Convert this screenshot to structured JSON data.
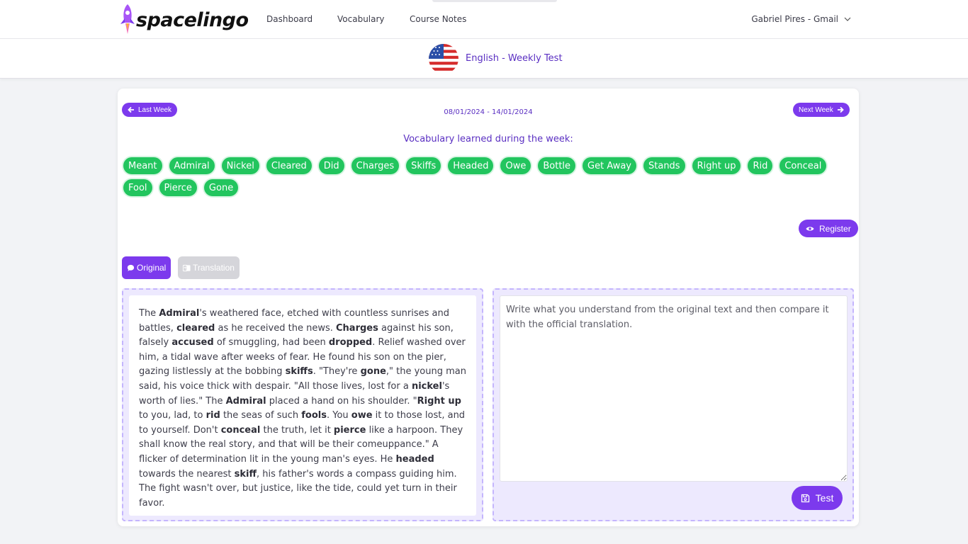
{
  "nav": {
    "logo_text": "spacelingo",
    "links": [
      "Dashboard",
      "Vocabulary",
      "Course Notes"
    ],
    "user": "Gabriel Pires - Gmail"
  },
  "header": {
    "title": "English - Weekly Test",
    "flag_icon": "us-flag-icon"
  },
  "week": {
    "prev_label": "Last Week",
    "next_label": "Next Week",
    "range": "08/01/2024 - 14/01/2024"
  },
  "vocab": {
    "title": "Vocabulary learned during the week:",
    "words": [
      "Meant",
      "Admiral",
      "Nickel",
      "Cleared",
      "Did",
      "Charges",
      "Skiffs",
      "Headed",
      "Owe",
      "Bottle",
      "Get Away",
      "Stands",
      "Right up",
      "Rid",
      "Conceal",
      "Fool",
      "Pierce",
      "Gone"
    ]
  },
  "register_label": "Register",
  "tabs": {
    "original": "Original",
    "translation": "Translation"
  },
  "original_text": [
    {
      "t": "The "
    },
    {
      "b": "Admiral"
    },
    {
      "t": "'s weathered face, etched with countless sunrises and battles, "
    },
    {
      "b": "cleared"
    },
    {
      "t": " as he received the news. "
    },
    {
      "b": "Charges"
    },
    {
      "t": " against his son, falsely "
    },
    {
      "b": "accused"
    },
    {
      "t": " of smuggling, had been "
    },
    {
      "b": "dropped"
    },
    {
      "t": ". Relief washed over him, a tidal wave after weeks of fear. He found his son on the pier, gazing listlessly at the bobbing "
    },
    {
      "b": "skiffs"
    },
    {
      "t": ". \"They're "
    },
    {
      "b": "gone"
    },
    {
      "t": ",\" the young man said, his voice thick with despair. \"All those lives, lost for a "
    },
    {
      "b": "nickel"
    },
    {
      "t": "'s worth of lies.\" The "
    },
    {
      "b": "Admiral"
    },
    {
      "t": " placed a hand on his shoulder. \""
    },
    {
      "b": "Right up"
    },
    {
      "t": " to you, lad, to "
    },
    {
      "b": "rid"
    },
    {
      "t": " the seas of such "
    },
    {
      "b": "fools"
    },
    {
      "t": ". You "
    },
    {
      "b": "owe"
    },
    {
      "t": " it to those lost, and to yourself. Don't "
    },
    {
      "b": "conceal"
    },
    {
      "t": " the truth, let it "
    },
    {
      "b": "pierce"
    },
    {
      "t": " like a harpoon. They shall know the real story, and that will be their comeuppance.\" A flicker of determination lit in the young man's eyes. He "
    },
    {
      "b": "headed"
    },
    {
      "t": " towards the nearest "
    },
    {
      "b": "skiff"
    },
    {
      "t": ", his father's words a compass guiding him. The fight wasn't over, but justice, like the tide, could yet turn in their favor."
    }
  ],
  "answer": {
    "placeholder": "Write what you understand from the original text and then compare it with the official translation.",
    "value": ""
  },
  "test_label": "Test",
  "colors": {
    "accent": "#7c3aed",
    "chip": "#22c55e",
    "title": "#5a2fc2"
  }
}
